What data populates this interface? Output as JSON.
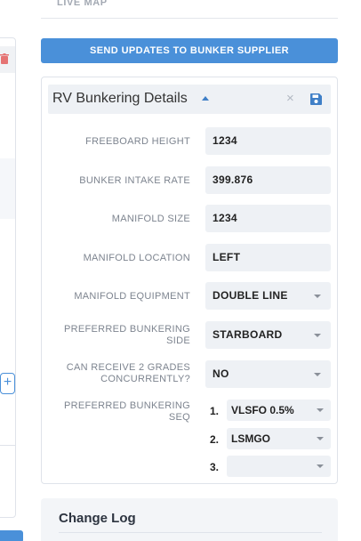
{
  "header": {
    "live_map": "LIVE MAP"
  },
  "actions": {
    "send_updates": "SEND UPDATES TO BUNKER SUPPLIER"
  },
  "left": {
    "plus": "+"
  },
  "panel": {
    "title": "RV Bunkering Details",
    "close": "×",
    "rows": [
      {
        "label": "FREEBOARD HEIGHT",
        "value": "1234"
      },
      {
        "label": "BUNKER INTAKE RATE",
        "value": "399.876"
      },
      {
        "label": "MANIFOLD SIZE",
        "value": "1234"
      },
      {
        "label": "MANIFOLD LOCATION",
        "value": "LEFT"
      },
      {
        "label": "MANIFOLD EQUIPMENT",
        "value": "DOUBLE LINE"
      },
      {
        "label": "PREFERRED BUNKERING SIDE",
        "value": "STARBOARD"
      },
      {
        "label": "CAN RECEIVE 2 GRADES CONCURRENTLY?",
        "value": "NO"
      }
    ],
    "seq": {
      "label": "PREFERRED BUNKERING SEQ",
      "items": [
        {
          "num": "1.",
          "value": "VLSFO 0.5%"
        },
        {
          "num": "2.",
          "value": "LSMGO"
        },
        {
          "num": "3.",
          "value": ""
        }
      ]
    }
  },
  "changelog": {
    "title": "Change Log"
  },
  "colors": {
    "accent": "#4a90d9",
    "danger": "#e57373",
    "field_bg": "#eef1f5"
  },
  "icons": [
    "trash-icon",
    "caret-up-icon",
    "close-icon",
    "save-icon",
    "chevron-down-icon",
    "plus-icon"
  ]
}
